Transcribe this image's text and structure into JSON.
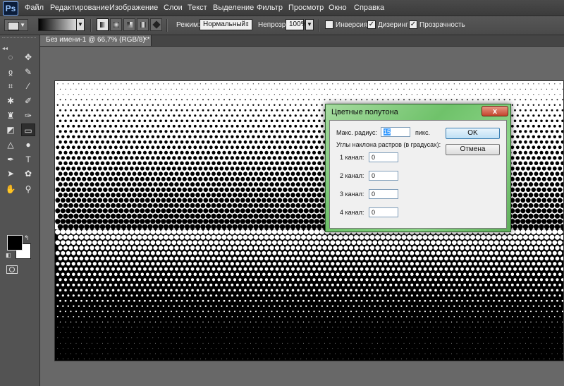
{
  "app": {
    "logo": "Ps"
  },
  "menu": [
    "Файл",
    "Редактирование",
    "Изображение",
    "Слои",
    "Текст",
    "Выделение",
    "Фильтр",
    "Просмотр",
    "Окно",
    "Справка"
  ],
  "options": {
    "mode_label": "Режим:",
    "mode_value": "Нормальный",
    "opacity_label": "Непрозр.:",
    "opacity_value": "100%",
    "inversion_label": "Инверсия",
    "inversion_checked": false,
    "dither_label": "Дизеринг",
    "dither_checked": true,
    "transparency_label": "Прозрачность",
    "transparency_checked": true
  },
  "document": {
    "tab_title": "Без имени-1 @ 66,7% (RGB/8) *",
    "close": "×"
  },
  "toolbar": {
    "tools": [
      "marquee-tool",
      "move-tool",
      "lasso-tool",
      "quick-selection-tool",
      "crop-tool",
      "eyedropper-tool",
      "spot-healing-tool",
      "brush-tool",
      "clone-stamp-tool",
      "history-brush-tool",
      "eraser-tool",
      "gradient-tool",
      "blur-tool",
      "dodge-tool",
      "pen-tool",
      "type-tool",
      "path-selection-tool",
      "shape-tool",
      "hand-tool",
      "zoom-tool"
    ],
    "foreground_color": "#000000",
    "background_color": "#ffffff"
  },
  "dialog": {
    "title": "Цветные полутона",
    "close": "x",
    "max_radius_label": "Макс. радиус:",
    "max_radius_value": "15",
    "max_radius_unit": "пикс.",
    "angles_label": "Углы наклона растров (в градусах):",
    "channels": [
      {
        "label": "1 канал:",
        "value": "0"
      },
      {
        "label": "2 канал:",
        "value": "0"
      },
      {
        "label": "3 канал:",
        "value": "0"
      },
      {
        "label": "4 канал:",
        "value": "0"
      }
    ],
    "ok_label": "OK",
    "cancel_label": "Отмена"
  }
}
